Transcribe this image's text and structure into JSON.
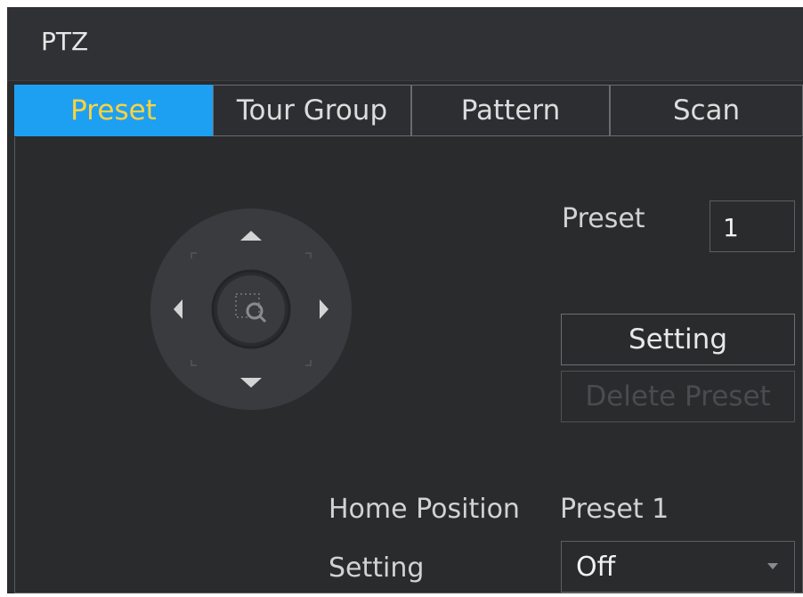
{
  "window": {
    "title": "PTZ"
  },
  "tabs": [
    {
      "label": "Preset",
      "active": true
    },
    {
      "label": "Tour Group",
      "active": false
    },
    {
      "label": "Pattern",
      "active": false
    },
    {
      "label": "Scan",
      "active": false
    }
  ],
  "preset": {
    "label": "Preset",
    "value": "1",
    "setting_button": "Setting",
    "delete_button": "Delete Preset"
  },
  "home_position": {
    "label": "Home Position",
    "value": "Preset 1",
    "setting_label": "Setting",
    "setting_value": "Off"
  },
  "colors": {
    "active_tab_bg": "#1ea0f2",
    "active_tab_text": "#ffd33d",
    "panel_bg": "#2a2b2d"
  },
  "icons": [
    "up-arrow-icon",
    "down-arrow-icon",
    "left-arrow-icon",
    "right-arrow-icon",
    "zoom-area-icon",
    "dropdown-caret-icon"
  ]
}
